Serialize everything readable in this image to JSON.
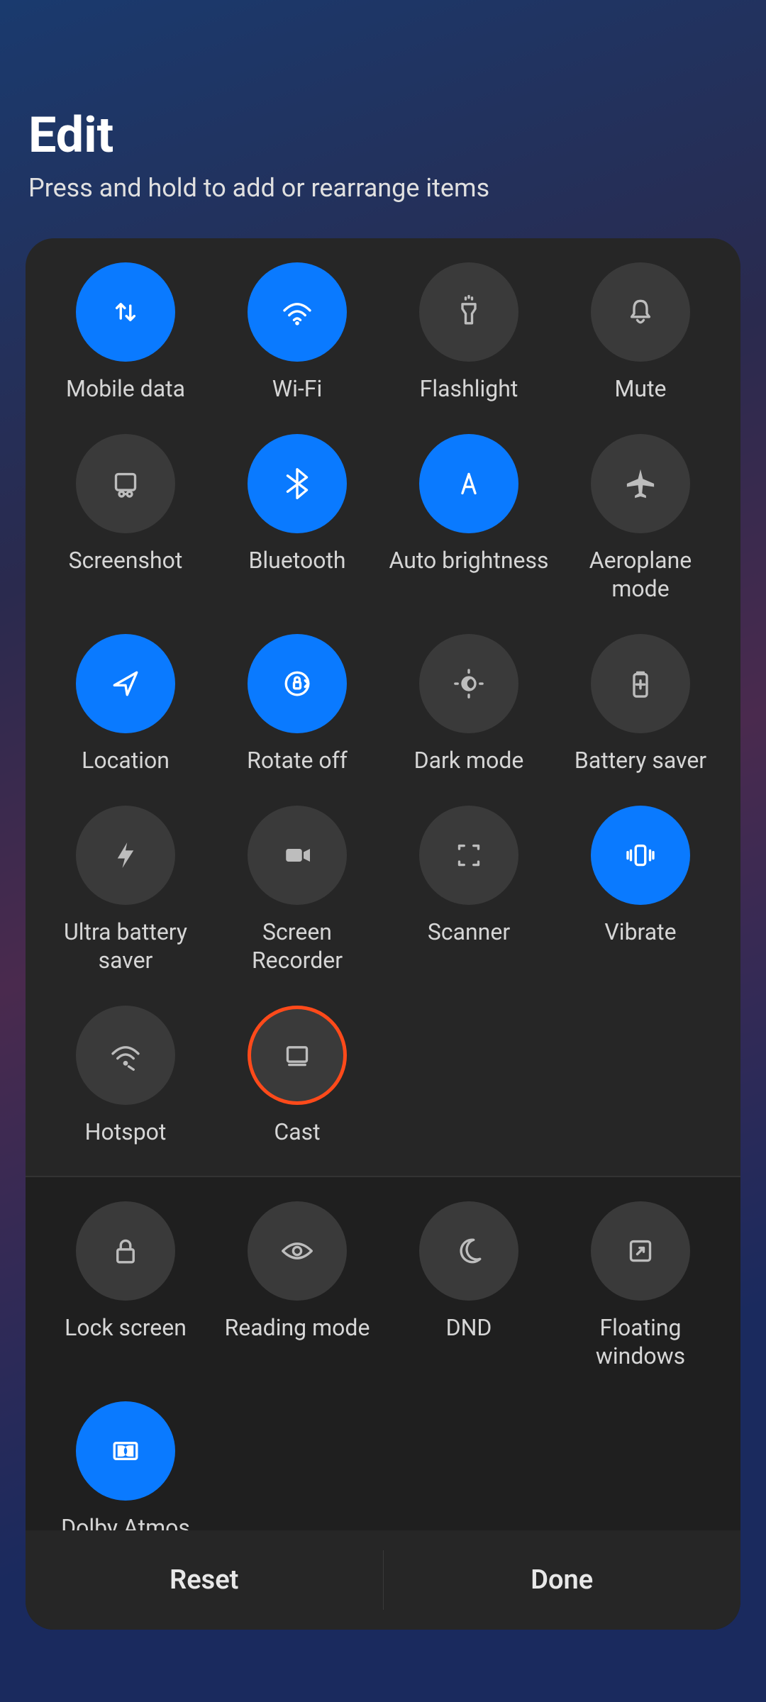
{
  "header": {
    "title": "Edit",
    "subtitle": "Press and hold to add or rearrange items"
  },
  "colors": {
    "accent": "#0a7aff",
    "highlight": "#ff4a1a"
  },
  "section_main": [
    {
      "id": "mobile-data",
      "label": "Mobile data",
      "icon": "mobile-data-icon",
      "active": true
    },
    {
      "id": "wifi",
      "label": "Wi-Fi",
      "icon": "wifi-icon",
      "active": true
    },
    {
      "id": "flashlight",
      "label": "Flashlight",
      "icon": "flashlight-icon",
      "active": false
    },
    {
      "id": "mute",
      "label": "Mute",
      "icon": "bell-icon",
      "active": false
    },
    {
      "id": "screenshot",
      "label": "Screenshot",
      "icon": "screenshot-icon",
      "active": false
    },
    {
      "id": "bluetooth",
      "label": "Bluetooth",
      "icon": "bluetooth-icon",
      "active": true
    },
    {
      "id": "auto-brightness",
      "label": "Auto brightness",
      "icon": "auto-brightness-icon",
      "active": true
    },
    {
      "id": "aeroplane-mode",
      "label": "Aeroplane\nmode",
      "icon": "airplane-icon",
      "active": false
    },
    {
      "id": "location",
      "label": "Location",
      "icon": "location-icon",
      "active": true
    },
    {
      "id": "rotate-off",
      "label": "Rotate off",
      "icon": "rotate-lock-icon",
      "active": true
    },
    {
      "id": "dark-mode",
      "label": "Dark mode",
      "icon": "dark-mode-icon",
      "active": false
    },
    {
      "id": "battery-saver",
      "label": "Battery saver",
      "icon": "battery-plus-icon",
      "active": false
    },
    {
      "id": "ultra-battery-saver",
      "label": "Ultra battery\nsaver",
      "icon": "bolt-icon",
      "active": false
    },
    {
      "id": "screen-recorder",
      "label": "Screen\nRecorder",
      "icon": "video-icon",
      "active": false
    },
    {
      "id": "scanner",
      "label": "Scanner",
      "icon": "scan-icon",
      "active": false
    },
    {
      "id": "vibrate",
      "label": "Vibrate",
      "icon": "vibrate-icon",
      "active": true
    },
    {
      "id": "hotspot",
      "label": "Hotspot",
      "icon": "hotspot-icon",
      "active": false
    },
    {
      "id": "cast",
      "label": "Cast",
      "icon": "cast-icon",
      "active": false,
      "highlighted": true
    }
  ],
  "section_more": [
    {
      "id": "lock-screen",
      "label": "Lock screen",
      "icon": "lock-icon",
      "active": false
    },
    {
      "id": "reading-mode",
      "label": "Reading mode",
      "icon": "eye-icon",
      "active": false
    },
    {
      "id": "dnd",
      "label": "DND",
      "icon": "moon-icon",
      "active": false
    },
    {
      "id": "floating-windows",
      "label": "Floating\nwindows",
      "icon": "floating-window-icon",
      "active": false
    },
    {
      "id": "dolby-atmos",
      "label": "Dolby Atmos",
      "icon": "dolby-icon",
      "active": true
    }
  ],
  "section_partial": [
    {
      "id": "partial-1",
      "icon": "generic-icon",
      "active": false
    },
    {
      "id": "partial-2",
      "icon": "sparkle-icon",
      "active": false
    },
    {
      "id": "partial-3",
      "icon": "generic-icon",
      "active": false
    },
    {
      "id": "partial-4",
      "icon": "fullscreen-icon",
      "active": false
    }
  ],
  "footer": {
    "reset": "Reset",
    "done": "Done"
  }
}
